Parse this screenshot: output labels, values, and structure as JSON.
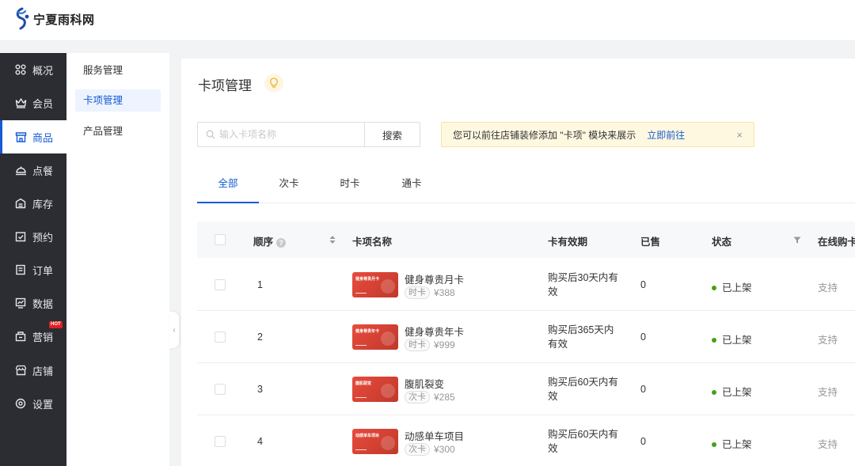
{
  "brand": {
    "logo_text": "宁夏雨科网"
  },
  "sidebar": {
    "items": [
      {
        "label": "概况",
        "icon": "grid-icon"
      },
      {
        "label": "会员",
        "icon": "crown-icon"
      },
      {
        "label": "商品",
        "icon": "shop-icon",
        "active": true
      },
      {
        "label": "点餐",
        "icon": "food-cover-icon"
      },
      {
        "label": "库存",
        "icon": "warehouse-icon"
      },
      {
        "label": "预约",
        "icon": "calendar-check-icon"
      },
      {
        "label": "订单",
        "icon": "order-list-icon"
      },
      {
        "label": "数据",
        "icon": "chart-icon"
      },
      {
        "label": "营销",
        "icon": "marketing-icon",
        "badge": "HOT"
      },
      {
        "label": "店铺",
        "icon": "store-icon"
      },
      {
        "label": "设置",
        "icon": "settings-icon"
      }
    ]
  },
  "subnav": {
    "items": [
      {
        "label": "服务管理"
      },
      {
        "label": "卡项管理",
        "active": true
      },
      {
        "label": "产品管理"
      }
    ]
  },
  "page": {
    "title": "卡项管理"
  },
  "search": {
    "placeholder": "输入卡项名称",
    "value": "",
    "button": "搜索"
  },
  "notice": {
    "text": "您可以前往店铺装修添加 \"卡项\" 模块来展示",
    "link": "立即前往",
    "close": "×"
  },
  "tabs": [
    {
      "label": "全部",
      "active": true
    },
    {
      "label": "次卡"
    },
    {
      "label": "时卡"
    },
    {
      "label": "通卡"
    }
  ],
  "table": {
    "headers": {
      "order": "顺序",
      "name": "卡项名称",
      "validity": "卡有效期",
      "sold": "已售",
      "status": "状态",
      "online": "在线购卡"
    },
    "rows": [
      {
        "order": "1",
        "thumb_text": "健身尊贵月卡",
        "name": "健身尊贵月卡",
        "tag": "时卡",
        "price": "¥388",
        "validity": "购买后30天内有效",
        "sold": "0",
        "status": "已上架",
        "online": "支持"
      },
      {
        "order": "2",
        "thumb_text": "健身尊贵年卡",
        "name": "健身尊贵年卡",
        "tag": "时卡",
        "price": "¥999",
        "validity": "购买后365天内有效",
        "sold": "0",
        "status": "已上架",
        "online": "支持"
      },
      {
        "order": "3",
        "thumb_text": "腹肌裂变",
        "name": "腹肌裂变",
        "tag": "次卡",
        "price": "¥285",
        "validity": "购买后60天内有效",
        "sold": "0",
        "status": "已上架",
        "online": "支持"
      },
      {
        "order": "4",
        "thumb_text": "动感单车项目",
        "name": "动感单车项目",
        "tag": "次卡",
        "price": "¥300",
        "validity": "购买后60天内有效",
        "sold": "0",
        "status": "已上架",
        "online": "支持"
      }
    ]
  },
  "colors": {
    "primary": "#155bd4",
    "sidebar_bg": "#2b2d33",
    "status_green": "#45a110",
    "card_red": "#e84b3c"
  }
}
